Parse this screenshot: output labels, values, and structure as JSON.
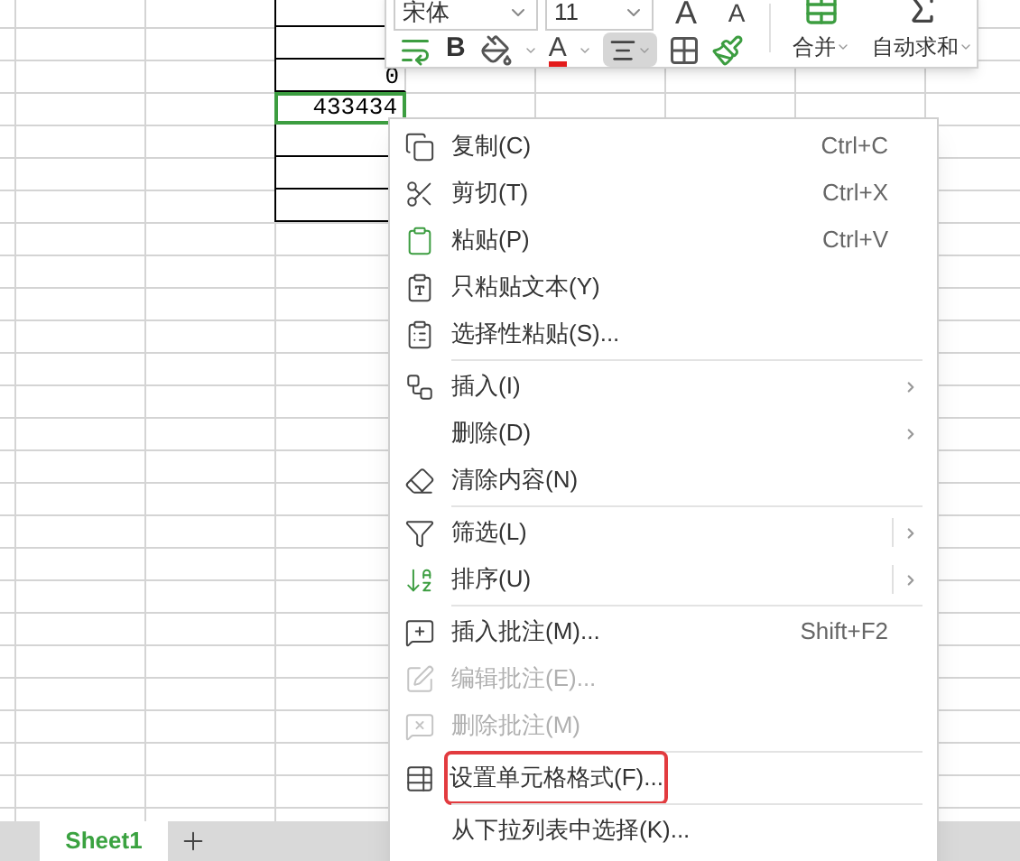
{
  "cells": [
    {
      "text": "0",
      "selected": false
    },
    {
      "text": "433434",
      "selected": true
    }
  ],
  "toolbar": {
    "font": "宋体",
    "size": "11",
    "grow": "A",
    "shrink": "A",
    "bold": "B",
    "font_color": "A",
    "align_selected": true,
    "merge": "合并",
    "autosum": "自动求和"
  },
  "menu": [
    {
      "kind": "item",
      "label": "复制(C)",
      "shortcut": "Ctrl+C",
      "submenu": false,
      "disabled": false,
      "selected": false
    },
    {
      "kind": "item",
      "label": "剪切(T)",
      "shortcut": "Ctrl+X",
      "submenu": false,
      "disabled": false,
      "selected": false
    },
    {
      "kind": "item",
      "label": "粘贴(P)",
      "shortcut": "Ctrl+V",
      "submenu": false,
      "disabled": false,
      "selected": false
    },
    {
      "kind": "item",
      "label": "只粘贴文本(Y)",
      "submenu": false,
      "disabled": false,
      "selected": false
    },
    {
      "kind": "item",
      "label": "选择性粘贴(S)...",
      "submenu": false,
      "disabled": false,
      "selected": false
    },
    {
      "kind": "separator"
    },
    {
      "kind": "item",
      "label": "插入(I)",
      "submenu": true,
      "disabled": false,
      "selected": false
    },
    {
      "kind": "item",
      "label": "删除(D)",
      "submenu": true,
      "disabled": false,
      "selected": false
    },
    {
      "kind": "item",
      "label": "清除内容(N)",
      "submenu": false,
      "disabled": false,
      "selected": false
    },
    {
      "kind": "separator"
    },
    {
      "kind": "split",
      "label": "筛选(L)",
      "submenu": true,
      "disabled": false,
      "selected": false
    },
    {
      "kind": "split",
      "label": "排序(U)",
      "submenu": true,
      "disabled": false,
      "selected": false
    },
    {
      "kind": "separator"
    },
    {
      "kind": "item",
      "label": "插入批注(M)...",
      "shortcut": "Shift+F2",
      "submenu": false,
      "disabled": false,
      "selected": false
    },
    {
      "kind": "item",
      "label": "编辑批注(E)...",
      "submenu": false,
      "disabled": true,
      "selected": false
    },
    {
      "kind": "item",
      "label": "删除批注(M)",
      "submenu": false,
      "disabled": true,
      "selected": false
    },
    {
      "kind": "separator"
    },
    {
      "kind": "item",
      "label": "设置单元格格式(F)...",
      "submenu": false,
      "disabled": false,
      "selected": true
    },
    {
      "kind": "separator"
    },
    {
      "kind": "item",
      "label": "从下拉列表中选择(K)...",
      "submenu": false,
      "disabled": false,
      "selected": false
    }
  ],
  "sheet_tabs": [
    {
      "label": "Sheet1",
      "selected": true
    }
  ]
}
